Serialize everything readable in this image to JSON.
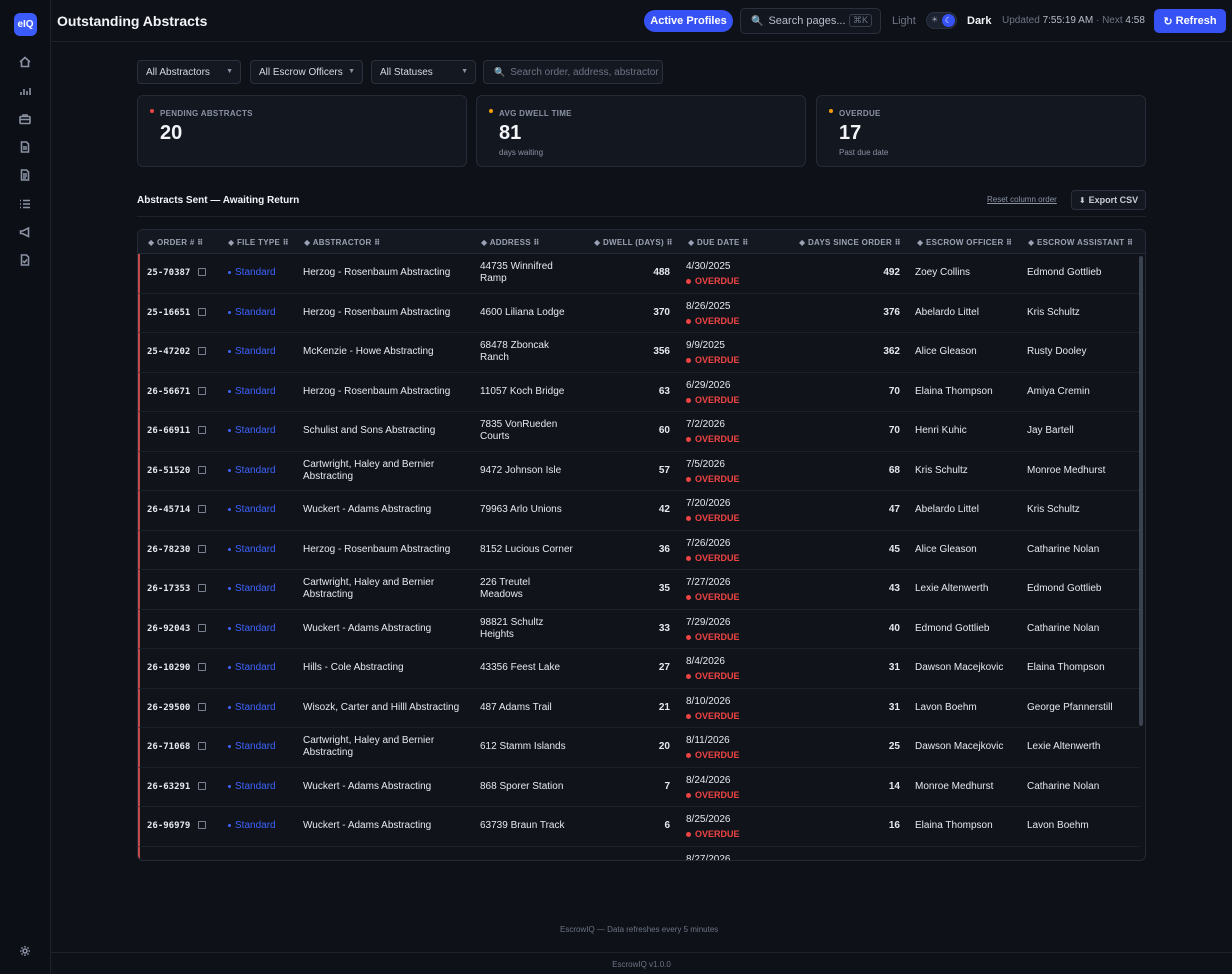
{
  "app": {
    "logo": "eIQ",
    "title": "Outstanding Abstracts"
  },
  "sidebar": {
    "items": [
      "home-icon",
      "chart-icon",
      "briefcase-icon",
      "document-icon",
      "file-text-icon",
      "list-icon",
      "megaphone-icon",
      "file-check-icon"
    ],
    "bottom": "settings-icon"
  },
  "header": {
    "active_profiles": "Active Profiles",
    "search_placeholder": "Search pages...",
    "search_shortcut": "⌘K",
    "theme_light": "Light",
    "theme_dark": "Dark",
    "updated_label": "Updated",
    "updated_time": "7:55:19 AM",
    "next_label": "· Next",
    "next_time": "4:58",
    "refresh": "Refresh"
  },
  "filters": {
    "abstractors": "All Abstractors",
    "escrow_officers": "All Escrow Officers",
    "statuses": "All Statuses",
    "search_placeholder": "Search order, address, abstractor"
  },
  "cards": [
    {
      "label": "PENDING ABSTRACTS",
      "value": "20",
      "sub": "",
      "color": "#ef4444"
    },
    {
      "label": "AVG DWELL TIME",
      "value": "81",
      "sub": "days waiting",
      "color": "#f59e0b"
    },
    {
      "label": "OVERDUE",
      "value": "17",
      "sub": "Past due date",
      "color": "#f59e0b"
    }
  ],
  "table": {
    "title": "Abstracts Sent — Awaiting Return",
    "reset": "Reset column order",
    "export": "Export CSV",
    "headers": [
      "ORDER #",
      "FILE TYPE",
      "ABSTRACTOR",
      "ADDRESS",
      "DWELL (DAYS)",
      "DUE DATE",
      "DAYS SINCE ORDER",
      "ESCROW OFFICER",
      "ESCROW ASSISTANT"
    ],
    "rows": [
      {
        "order": "25-70387",
        "type": "Standard",
        "abstractor": "Herzog - Rosenbaum Abstracting",
        "address": "44735 Winnifred Ramp",
        "dwell": "488",
        "due": "4/30/2025",
        "status": "OVERDUE",
        "since": "492",
        "officer": "Zoey Collins",
        "assistant": "Edmond Gottlieb"
      },
      {
        "order": "25-16651",
        "type": "Standard",
        "abstractor": "Herzog - Rosenbaum Abstracting",
        "address": "4600 Liliana Lodge",
        "dwell": "370",
        "due": "8/26/2025",
        "status": "OVERDUE",
        "since": "376",
        "officer": "Abelardo Littel",
        "assistant": "Kris Schultz"
      },
      {
        "order": "25-47202",
        "type": "Standard",
        "abstractor": "McKenzie - Howe Abstracting",
        "address": "68478 Zboncak Ranch",
        "dwell": "356",
        "due": "9/9/2025",
        "status": "OVERDUE",
        "since": "362",
        "officer": "Alice Gleason",
        "assistant": "Rusty Dooley"
      },
      {
        "order": "26-56671",
        "type": "Standard",
        "abstractor": "Herzog - Rosenbaum Abstracting",
        "address": "11057 Koch Bridge",
        "dwell": "63",
        "due": "6/29/2026",
        "status": "OVERDUE",
        "since": "70",
        "officer": "Elaina Thompson",
        "assistant": "Amiya Cremin"
      },
      {
        "order": "26-66911",
        "type": "Standard",
        "abstractor": "Schulist and Sons Abstracting",
        "address": "7835 VonRueden Courts",
        "dwell": "60",
        "due": "7/2/2026",
        "status": "OVERDUE",
        "since": "70",
        "officer": "Henri Kuhic",
        "assistant": "Jay Bartell"
      },
      {
        "order": "26-51520",
        "type": "Standard",
        "abstractor": "Cartwright, Haley and Bernier Abstracting",
        "address": "9472 Johnson Isle",
        "dwell": "57",
        "due": "7/5/2026",
        "status": "OVERDUE",
        "since": "68",
        "officer": "Kris Schultz",
        "assistant": "Monroe Medhurst"
      },
      {
        "order": "26-45714",
        "type": "Standard",
        "abstractor": "Wuckert - Adams Abstracting",
        "address": "79963 Arlo Unions",
        "dwell": "42",
        "due": "7/20/2026",
        "status": "OVERDUE",
        "since": "47",
        "officer": "Abelardo Littel",
        "assistant": "Kris Schultz"
      },
      {
        "order": "26-78230",
        "type": "Standard",
        "abstractor": "Herzog - Rosenbaum Abstracting",
        "address": "8152 Lucious Corner",
        "dwell": "36",
        "due": "7/26/2026",
        "status": "OVERDUE",
        "since": "45",
        "officer": "Alice Gleason",
        "assistant": "Catharine Nolan"
      },
      {
        "order": "26-17353",
        "type": "Standard",
        "abstractor": "Cartwright, Haley and Bernier Abstracting",
        "address": "226 Treutel Meadows",
        "dwell": "35",
        "due": "7/27/2026",
        "status": "OVERDUE",
        "since": "43",
        "officer": "Lexie Altenwerth",
        "assistant": "Edmond Gottlieb"
      },
      {
        "order": "26-92043",
        "type": "Standard",
        "abstractor": "Wuckert - Adams Abstracting",
        "address": "98821 Schultz Heights",
        "dwell": "33",
        "due": "7/29/2026",
        "status": "OVERDUE",
        "since": "40",
        "officer": "Edmond Gottlieb",
        "assistant": "Catharine Nolan"
      },
      {
        "order": "26-10290",
        "type": "Standard",
        "abstractor": "Hills - Cole Abstracting",
        "address": "43356 Feest Lake",
        "dwell": "27",
        "due": "8/4/2026",
        "status": "OVERDUE",
        "since": "31",
        "officer": "Dawson Macejkovic",
        "assistant": "Elaina Thompson"
      },
      {
        "order": "26-29500",
        "type": "Standard",
        "abstractor": "Wisozk, Carter and Hilll Abstracting",
        "address": "487 Adams Trail",
        "dwell": "21",
        "due": "8/10/2026",
        "status": "OVERDUE",
        "since": "31",
        "officer": "Lavon Boehm",
        "assistant": "George Pfannerstill"
      },
      {
        "order": "26-71068",
        "type": "Standard",
        "abstractor": "Cartwright, Haley and Bernier Abstracting",
        "address": "612 Stamm Islands",
        "dwell": "20",
        "due": "8/11/2026",
        "status": "OVERDUE",
        "since": "25",
        "officer": "Dawson Macejkovic",
        "assistant": "Lexie Altenwerth"
      },
      {
        "order": "26-63291",
        "type": "Standard",
        "abstractor": "Wuckert - Adams Abstracting",
        "address": "868 Sporer Station",
        "dwell": "7",
        "due": "8/24/2026",
        "status": "OVERDUE",
        "since": "14",
        "officer": "Monroe Medhurst",
        "assistant": "Catharine Nolan"
      },
      {
        "order": "26-96979",
        "type": "Standard",
        "abstractor": "Wuckert - Adams Abstracting",
        "address": "63739 Braun Track",
        "dwell": "6",
        "due": "8/25/2026",
        "status": "OVERDUE",
        "since": "16",
        "officer": "Elaina Thompson",
        "assistant": "Lavon Boehm"
      },
      {
        "order": "",
        "type": "",
        "abstractor": "",
        "address": "",
        "dwell": "",
        "due": "8/27/2026",
        "status": "",
        "since": "",
        "officer": "",
        "assistant": ""
      }
    ]
  },
  "footer": {
    "note": "EscrowIQ — Data refreshes every 5 minutes",
    "version": "EscrowIQ v1.0.0"
  }
}
